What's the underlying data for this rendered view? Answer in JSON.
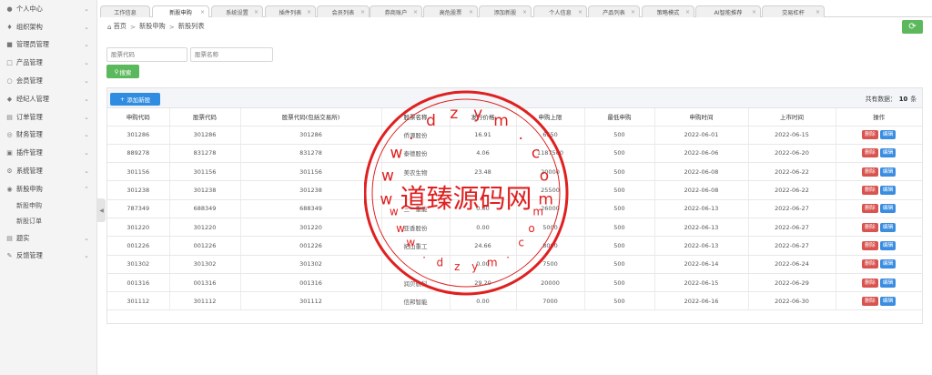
{
  "sidebar": {
    "items": [
      {
        "label": "个人中心",
        "icon": "person-icon",
        "glyph": "●"
      },
      {
        "label": "组织架构",
        "icon": "org-icon",
        "glyph": "♦"
      },
      {
        "label": "管理员管理",
        "icon": "admin-icon",
        "glyph": "■"
      },
      {
        "label": "产品管理",
        "icon": "product-icon",
        "glyph": "□"
      },
      {
        "label": "会员管理",
        "icon": "member-icon",
        "glyph": "○"
      },
      {
        "label": "经纪人管理",
        "icon": "broker-icon",
        "glyph": "◆"
      },
      {
        "label": "订单管理",
        "icon": "order-icon",
        "glyph": "▤"
      },
      {
        "label": "财务管理",
        "icon": "finance-icon",
        "glyph": "◎"
      },
      {
        "label": "插件管理",
        "icon": "plugin-icon",
        "glyph": "▣"
      },
      {
        "label": "系统管理",
        "icon": "system-icon",
        "glyph": "⚙"
      },
      {
        "label": "新股申购",
        "icon": "ipo-icon",
        "glyph": "◉"
      }
    ],
    "sub_items": [
      {
        "label": "新股申购"
      },
      {
        "label": "新股订单"
      }
    ],
    "bottom_items": [
      {
        "label": "题实",
        "icon": "doc-icon",
        "glyph": "▤"
      },
      {
        "label": "反馈管理",
        "icon": "feedback-icon",
        "glyph": "✎"
      }
    ]
  },
  "tabs": [
    {
      "label": "工作信息",
      "closable": false,
      "active": false
    },
    {
      "label": "新股申购",
      "closable": true,
      "active": true
    },
    {
      "label": "系统设置",
      "closable": true,
      "active": false
    },
    {
      "label": "插件列表",
      "closable": true,
      "active": false
    },
    {
      "label": "会员列表",
      "closable": true,
      "active": false
    },
    {
      "label": "券商账户",
      "closable": true,
      "active": false
    },
    {
      "label": "高危股票",
      "closable": true,
      "active": false
    },
    {
      "label": "添加新股",
      "closable": true,
      "active": false
    },
    {
      "label": "个人信息",
      "closable": true,
      "active": false
    },
    {
      "label": "产品列表",
      "closable": true,
      "active": false
    },
    {
      "label": "策略模式",
      "closable": true,
      "active": false
    },
    {
      "label": "AI智能推荐",
      "closable": true,
      "active": false
    },
    {
      "label": "交易杠杆",
      "closable": true,
      "active": false
    }
  ],
  "breadcrumb": {
    "home": "首页",
    "level1": "新股申购",
    "level2": "新股列表"
  },
  "search": {
    "code_placeholder": "股票代码",
    "name_placeholder": "股票名称",
    "button_label": "搜索"
  },
  "panel": {
    "add_label": "添加新股",
    "count_prefix": "共有数据：",
    "count_value": "10",
    "count_suffix": "条"
  },
  "table": {
    "headers": [
      "申购代码",
      "股票代码",
      "股票代码(包括交易所)",
      "股票名称",
      "发行价格",
      "申购上限",
      "最低申购",
      "申购时间",
      "上市时间",
      "操作"
    ],
    "rows": [
      [
        "301286",
        "301286",
        "301286",
        "侨源股份",
        "16.91",
        "6550",
        "500",
        "2022-06-01",
        "2022-06-15"
      ],
      [
        "889278",
        "831278",
        "831278",
        "泰德股份",
        "4.06",
        "1187500",
        "500",
        "2022-06-06",
        "2022-06-20"
      ],
      [
        "301156",
        "301156",
        "301156",
        "美农生物",
        "23.48",
        "20000",
        "500",
        "2022-06-08",
        "2022-06-22"
      ],
      [
        "301238",
        "301238",
        "301238",
        "",
        "",
        "25500",
        "500",
        "2022-06-08",
        "2022-06-22"
      ],
      [
        "787349",
        "688349",
        "688349",
        "三一重能",
        "0.00",
        "26000",
        "500",
        "2022-06-13",
        "2022-06-27"
      ],
      [
        "301220",
        "301220",
        "301220",
        "亚香股份",
        "0.00",
        "5000",
        "500",
        "2022-06-13",
        "2022-06-27"
      ],
      [
        "001226",
        "001226",
        "001226",
        "拓山重工",
        "24.66",
        "8000",
        "500",
        "2022-06-13",
        "2022-06-27"
      ],
      [
        "301302",
        "301302",
        "301302",
        "",
        "0.00",
        "7500",
        "500",
        "2022-06-14",
        "2022-06-24"
      ],
      [
        "001316",
        "001316",
        "001316",
        "润贝航科",
        "29.20",
        "20000",
        "500",
        "2022-06-15",
        "2022-06-29"
      ],
      [
        "301112",
        "301112",
        "301112",
        "信邦智能",
        "0.00",
        "7000",
        "500",
        "2022-06-16",
        "2022-06-30"
      ]
    ],
    "delete_label": "删除",
    "edit_label": "编辑"
  },
  "watermark": {
    "main_text": "道臻源码网",
    "url_text": "www.dzym.com"
  },
  "colors": {
    "green": "#5cb85c",
    "blue": "#2f8ce0",
    "red": "#d9534f",
    "stamp": "#e02020"
  }
}
